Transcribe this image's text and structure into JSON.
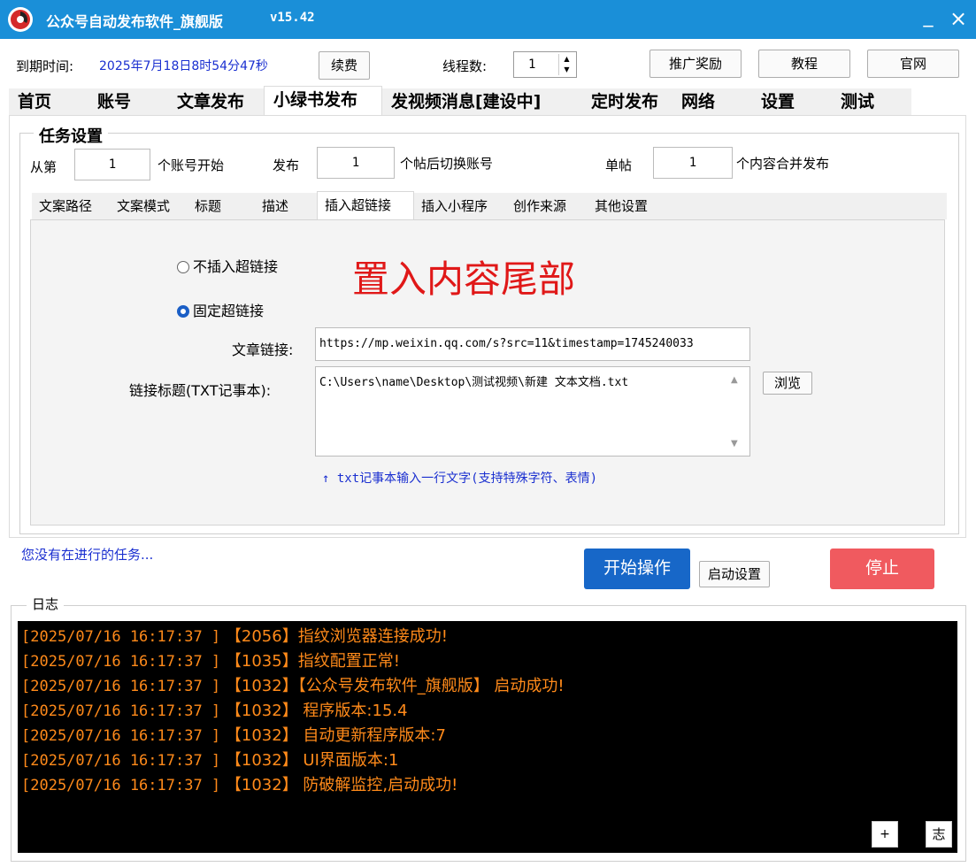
{
  "window": {
    "title": "公众号自动发布软件_旗舰版",
    "version": "v15.42",
    "minimize_glyph": "_",
    "close_glyph": "×",
    "titlebar_color": "#1a8fd8"
  },
  "header": {
    "expire_label": "到期时间:",
    "expire_value": "2025年7月18日8时54分47秒",
    "renew_label": "续费",
    "threads_label": "线程数:",
    "threads_value": "1",
    "promo_label": "推广奖励",
    "tutorial_label": "教程",
    "website_label": "官网"
  },
  "main_tabs": [
    {
      "label": "首页",
      "active": false
    },
    {
      "label": "账号",
      "active": false
    },
    {
      "label": "文章发布",
      "active": false
    },
    {
      "label": "小绿书发布",
      "active": true
    },
    {
      "label": "发视频消息[建设中]",
      "active": false
    },
    {
      "label": "定时发布",
      "active": false
    },
    {
      "label": "网络",
      "active": false
    },
    {
      "label": "设置",
      "active": false
    },
    {
      "label": "测试",
      "active": false
    }
  ],
  "task_settings": {
    "legend": "任务设置",
    "from_label": "从第",
    "from_value": "1",
    "from_suffix": "个账号开始",
    "publish_label": "发布",
    "publish_value": "1",
    "publish_suffix": "个帖后切换账号",
    "single_label": "单帖",
    "single_value": "1",
    "single_suffix": "个内容合并发布"
  },
  "sub_tabs": [
    {
      "label": "文案路径",
      "active": false
    },
    {
      "label": "文案模式",
      "active": false
    },
    {
      "label": "标题",
      "active": false
    },
    {
      "label": "描述",
      "active": false
    },
    {
      "label": "插入超链接",
      "active": true
    },
    {
      "label": "插入小程序",
      "active": false
    },
    {
      "label": "创作来源",
      "active": false
    },
    {
      "label": "其他设置",
      "active": false
    }
  ],
  "hyperlink": {
    "option_none": "不插入超链接",
    "option_fixed": "固定超链接",
    "selected": "fixed",
    "overlay_text": "置入内容尾部",
    "overlay_color": "#e01818",
    "link_label": "文章链接:",
    "link_value": "https://mp.weixin.qq.com/s?src=11&timestamp=1745240033",
    "title_label": "链接标题(TXT记事本):",
    "title_value": "C:\\Users\\name\\Desktop\\测试视频\\新建 文本文档.txt",
    "browse_label": "浏览",
    "hint": "↑  txt记事本输入一行文字(支持特殊字符、表情)"
  },
  "status": {
    "text": "您没有在进行的任务...",
    "start_label": "开始操作",
    "startup_settings_label": "启动设置",
    "stop_label": "停止",
    "start_color": "#1767c8",
    "stop_color": "#f05a5f"
  },
  "log": {
    "legend": "日志",
    "lines": [
      {
        "ts": "[2025/07/16 16:17:37 ]",
        "msg": " 【2056】指纹浏览器连接成功!"
      },
      {
        "ts": "[2025/07/16 16:17:37 ]",
        "msg": " 【1035】指纹配置正常!"
      },
      {
        "ts": "[2025/07/16 16:17:37 ]",
        "msg": " 【1032】【公众号发布软件_旗舰版】 启动成功!"
      },
      {
        "ts": "[2025/07/16 16:17:37 ]",
        "msg": " 【1032】 程序版本:15.4"
      },
      {
        "ts": "[2025/07/16 16:17:37 ]",
        "msg": " 【1032】 自动更新程序版本:7"
      },
      {
        "ts": "[2025/07/16 16:17:37 ]",
        "msg": " 【1032】 UI界面版本:1"
      },
      {
        "ts": "[2025/07/16 16:17:37 ]",
        "msg": " 【1032】 防破解监控,启动成功!"
      }
    ],
    "plus_label": "+",
    "zhi_label": "志",
    "text_color": "#ff8a1a"
  }
}
